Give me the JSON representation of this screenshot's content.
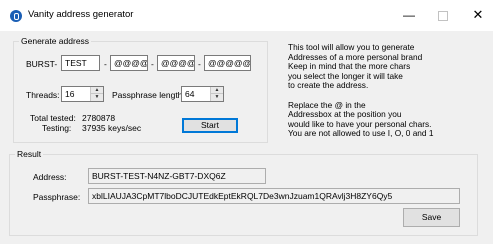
{
  "window": {
    "title": "Vanity address generator",
    "min_glyph": "—",
    "close_glyph": "✕"
  },
  "generate": {
    "legend": "Generate address",
    "prefix_label": "BURST-",
    "parts": [
      "TEST",
      "@@@@",
      "@@@@",
      "@@@@@"
    ],
    "separator": "-",
    "threads_label": "Threads:",
    "threads_value": "16",
    "passphrase_length_label": "Passphrase length:",
    "passphrase_length_value": "64",
    "total_tested_label": "Total tested:",
    "total_tested_value": "2780878",
    "testing_label": "Testing:",
    "testing_value": "37935 keys/sec",
    "start_label": "Start"
  },
  "info": {
    "paragraph1": [
      "This tool will allow you to generate",
      "Addresses of a more personal brand",
      "Keep in mind that the more chars",
      "you select the longer it will take",
      "to create the address."
    ],
    "paragraph2": [
      "Replace the @ in the",
      "Addressbox at the position you",
      "would like to have your personal chars.",
      "You are not allowed to use I, O, 0 and 1"
    ]
  },
  "result": {
    "legend": "Result",
    "address_label": "Address:",
    "address_value": "BURST-TEST-N4NZ-GBT7-DXQ6Z",
    "passphrase_label": "Passphrase:",
    "passphrase_value": "xblLIAUJA3CpMT7lboDCJUTEdkEptEkRQL7De3wnJzuam1QRAvlj3H8ZY6Qy5",
    "save_label": "Save"
  }
}
